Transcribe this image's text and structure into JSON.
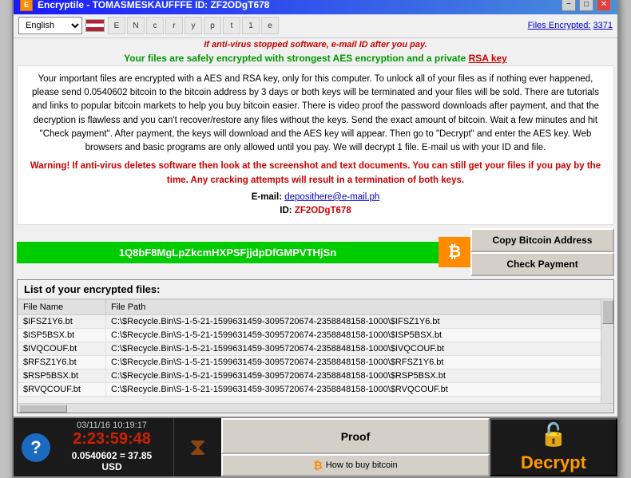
{
  "window": {
    "title": "Encryptile - TOMASMESKAUFFFE ID: ZF2ODgT678",
    "icon_label": "E"
  },
  "titlebar": {
    "minimize": "−",
    "maximize": "□",
    "close": "✕"
  },
  "toolbar": {
    "language": "English",
    "files_encrypted_label": "Files Encrypted:",
    "files_encrypted_count": "3371"
  },
  "alert": {
    "antivirus_warning": "If anti-virus stopped software, e-mail ID after you pay.",
    "safe_message": "Your files are safely encrypted with strongest AES encryption and a private ",
    "rsa_link": "RSA key"
  },
  "main_text": {
    "body": "Your important files are encrypted with a AES and RSA key, only for this computer. To unlock all of your files as if nothing ever happened, please send 0.0540602 bitcoin to the bitcoin address by 3 days or both keys will be terminated and your files will be sold. There are tutorials and links to popular bitcoin markets to help you buy bitcoin easier. There is video proof the password downloads after payment, and that the decryption is flawless and you can't recover/restore any files without the keys. Send the exact amount of bitcoin. Wait a few minutes and hit \"Check payment\". After payment, the keys will download and the AES key will appear. Then go to \"Decrypt\" and enter the AES key. Web browsers and basic programs are only allowed until you pay. We will decrypt 1 file. E-mail us with your ID and file.",
    "warning": "Warning! If anti-virus deletes software then look at the screenshot and text documents. You can still get your files if you pay by the time. Any cracking attempts will result in a termination of both keys.",
    "email_label": "E-mail:",
    "email": "deposithere@e-mail.ph",
    "id_label": "ID:",
    "id": "ZF2ODgT678"
  },
  "bitcoin": {
    "address": "1Q8bF8MgLpZkcmHXPSFjjdpDfGMPVTHjSn",
    "symbol": "₿",
    "copy_btn": "Copy Bitcoin Address",
    "check_btn": "Check Payment"
  },
  "file_list": {
    "title": "List of your encrypted files:",
    "col_filename": "File Name",
    "col_filepath": "File Path",
    "files": [
      {
        "name": "$IFSZ1Y6.bt",
        "path": "C:\\$Recycle.Bin\\S-1-5-21-1599631459-3095720674-2358848158-1000\\$IFSZ1Y6.bt"
      },
      {
        "name": "$ISP5BSX.bt",
        "path": "C:\\$Recycle.Bin\\S-1-5-21-1599631459-3095720674-2358848158-1000\\$ISP5BSX.bt"
      },
      {
        "name": "$IVQCOUF.bt",
        "path": "C:\\$Recycle.Bin\\S-1-5-21-1599631459-3095720674-2358848158-1000\\$IVQCOUF.bt"
      },
      {
        "name": "$RFSZ1Y6.bt",
        "path": "C:\\$Recycle.Bin\\S-1-5-21-1599631459-3095720674-2358848158-1000\\$RFSZ1Y6.bt"
      },
      {
        "name": "$RSP5BSX.bt",
        "path": "C:\\$Recycle.Bin\\S-1-5-21-1599631459-3095720674-2358848158-1000\\$RSP5BSX.bt"
      },
      {
        "name": "$RVQCOUF.bt",
        "path": "C:\\$Recycle.Bin\\S-1-5-21-1599631459-3095720674-2358848158-1000\\$RVQCOUF.bt"
      }
    ]
  },
  "bottom": {
    "datetime": "03/11/16 10:19:17",
    "countdown": "2:23:59:48",
    "price": "0.0540602 = 37.85 USD",
    "proof_btn": "Proof",
    "how_bitcoin_btn": "How to buy bitcoin",
    "decrypt_btn": "Decrypt"
  }
}
